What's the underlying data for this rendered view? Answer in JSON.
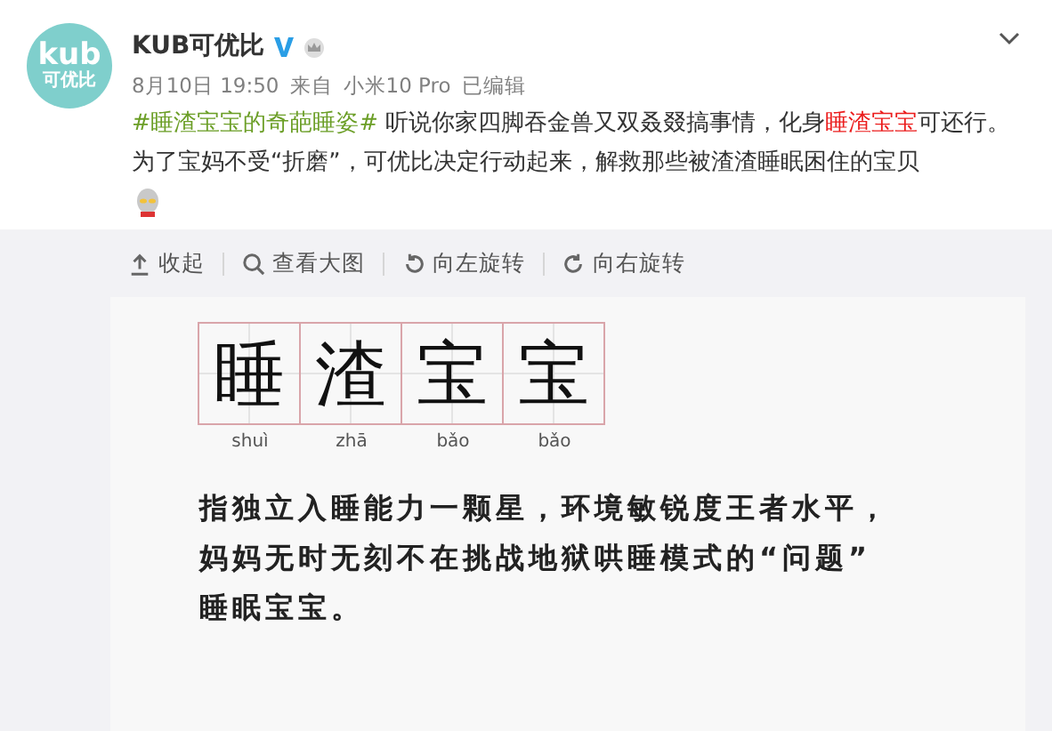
{
  "account": {
    "logo_text": "kub",
    "logo_subtext": "可优比",
    "name": "KUB可优比",
    "verified": true
  },
  "meta": {
    "date": "8月10日 19:50",
    "source_prefix": "来自",
    "device": "小米10 Pro",
    "edited": "已编辑"
  },
  "post": {
    "segments": [
      {
        "kind": "topic",
        "text": "#睡渣宝宝的奇葩睡姿#"
      },
      {
        "kind": "plain",
        "text": " 听说你家四脚吞金兽又双叒叕搞事情，化身"
      },
      {
        "kind": "keyword",
        "text": "睡渣宝宝"
      },
      {
        "kind": "plain",
        "text": "可还行。为了宝妈不受“折磨”，可优比决定行动起来，解救那些被渣渣睡眠困住的宝贝"
      }
    ],
    "emoji": true
  },
  "toolbar": [
    {
      "kind": "collapse",
      "label": "收起"
    },
    {
      "kind": "zoom",
      "label": "查看大图"
    },
    {
      "kind": "rotate-left",
      "label": "向左旋转"
    },
    {
      "kind": "rotate-right",
      "label": "向右旋转"
    }
  ],
  "image": {
    "characters": [
      {
        "char": "睡",
        "pinyin": "shuì"
      },
      {
        "char": "渣",
        "pinyin": "zhā"
      },
      {
        "char": "宝",
        "pinyin": "bǎo"
      },
      {
        "char": "宝",
        "pinyin": "bǎo"
      }
    ],
    "lines": [
      "指独立入睡能力一颗星，环境敏锐度王者水平，",
      "妈妈无时无刻不在挑战地狱哄睡模式的“问题”",
      "睡眠宝宝。"
    ]
  }
}
